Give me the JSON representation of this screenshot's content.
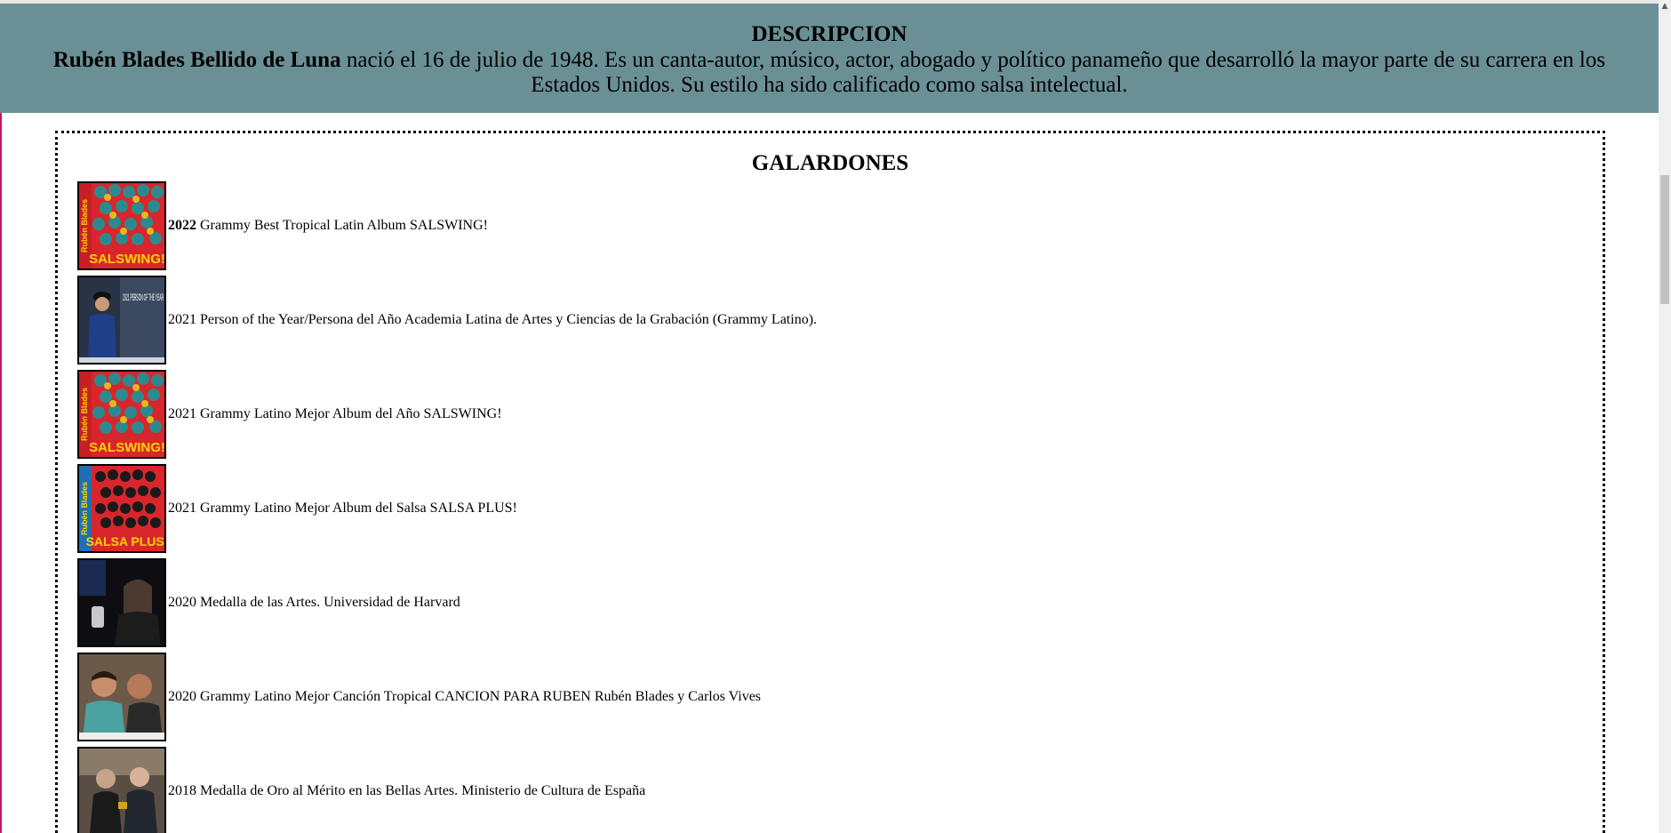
{
  "description": {
    "heading": "DESCRIPCION",
    "name": "Rubén Blades Bellido de Luna",
    "text": " nació el 16 de julio de 1948. Es un canta-autor, músico, actor, abogado y político panameño que desarrolló la mayor parte de su carrera en los Estados Unidos. Su estilo ha sido calificado como salsa intelectual."
  },
  "awards": {
    "heading": "GALARDONES",
    "items": [
      {
        "year": "2022",
        "text": " Grammy Best Tropical Latin Album SALSWING!",
        "image": "salswing-cover",
        "year_bold": true
      },
      {
        "year": "",
        "text": "2021 Person of the Year/Persona del Año Academia Latina de Artes y Ciencias de la Grabación (Grammy Latino).",
        "image": "person-of-year-photo",
        "year_bold": false
      },
      {
        "year": "",
        "text": "2021 Grammy Latino Mejor Album del Año SALSWING!",
        "image": "salswing-cover",
        "year_bold": false
      },
      {
        "year": "",
        "text": "2021 Grammy Latino Mejor Album del Salsa SALSA PLUS!",
        "image": "salsa-plus-cover",
        "year_bold": false
      },
      {
        "year": "",
        "text": "2020 Medalla de las Artes. Universidad de Harvard",
        "image": "harvard-photo",
        "year_bold": false
      },
      {
        "year": "",
        "text": "2020 Grammy Latino Mejor Canción Tropical CANCION PARA RUBEN Rubén Blades y Carlos Vives",
        "image": "vives-photo",
        "year_bold": false
      },
      {
        "year": "",
        "text": "2018 Medalla de Oro al Mérito en las Bellas Artes. Ministerio de Cultura de España",
        "image": "medal-photo",
        "year_bold": false
      }
    ],
    "thumb_labels": {
      "salswing": "SALSWING!",
      "salsa_plus": "SALSA PLUS!",
      "person_year": "2021 PERSON OF THE YEAR",
      "cover_artist": "Rubén Blades"
    }
  },
  "colors": {
    "header_bg": "#6a9096",
    "salswing_red": "#d8262c",
    "salsa_plus_blue": "#1f6fb2"
  }
}
